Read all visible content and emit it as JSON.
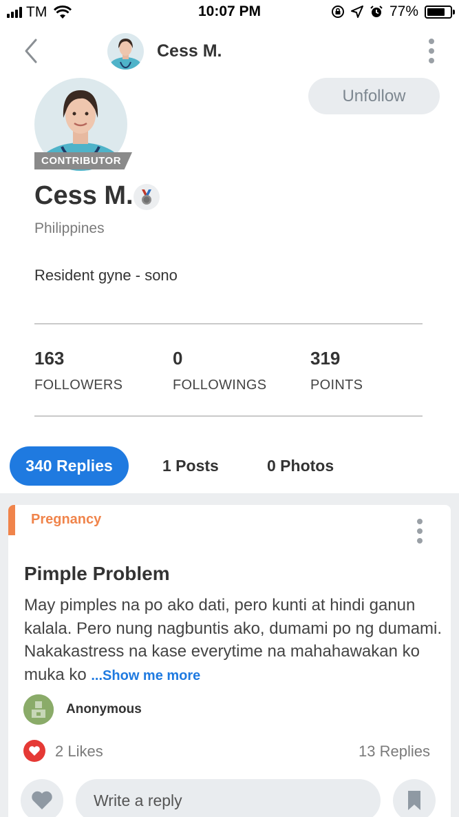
{
  "status_bar": {
    "carrier": "TM",
    "time": "10:07 PM",
    "battery_percent": "77%",
    "battery_level": 0.77,
    "icons": [
      "signal-icon",
      "wifi-icon",
      "screen-lock-icon",
      "location-icon",
      "alarm-icon",
      "battery-icon"
    ]
  },
  "header": {
    "title": "Cess M.",
    "icons": [
      "back-chevron-icon",
      "more-vertical-icon"
    ]
  },
  "profile": {
    "badge": "CONTRIBUTOR",
    "unfollow_label": "Unfollow",
    "name": "Cess M.",
    "location": "Philippines",
    "bio": "Resident gyne - sono",
    "medal_icon": "medal-icon",
    "stats": {
      "followers": {
        "value": "163",
        "label": "FOLLOWERS"
      },
      "followings": {
        "value": "0",
        "label": "FOLLOWINGS"
      },
      "points": {
        "value": "319",
        "label": "POINTS"
      }
    }
  },
  "tabs": [
    {
      "label": "340 Replies",
      "active": true
    },
    {
      "label": "1 Posts",
      "active": false
    },
    {
      "label": "0 Photos",
      "active": false
    }
  ],
  "post": {
    "category": "Pregnancy",
    "title": "Pimple Problem",
    "body": "May pimples na po ako dati, pero kunti at hindi ganun kalala. Pero nung nagbuntis ako, dumami po ng dumami. Nakakastress na kase everytime na mahahawakan ko muka ko ",
    "show_more": "...Show me more",
    "author": "Anonymous",
    "likes": "2 Likes",
    "replies": "13 Replies",
    "reply_placeholder": "Write a reply"
  },
  "colors": {
    "accent_blue": "#1f7ae0",
    "category_orange": "#f0844b",
    "like_red": "#e53935",
    "badge_gray": "#8a8a8a"
  }
}
